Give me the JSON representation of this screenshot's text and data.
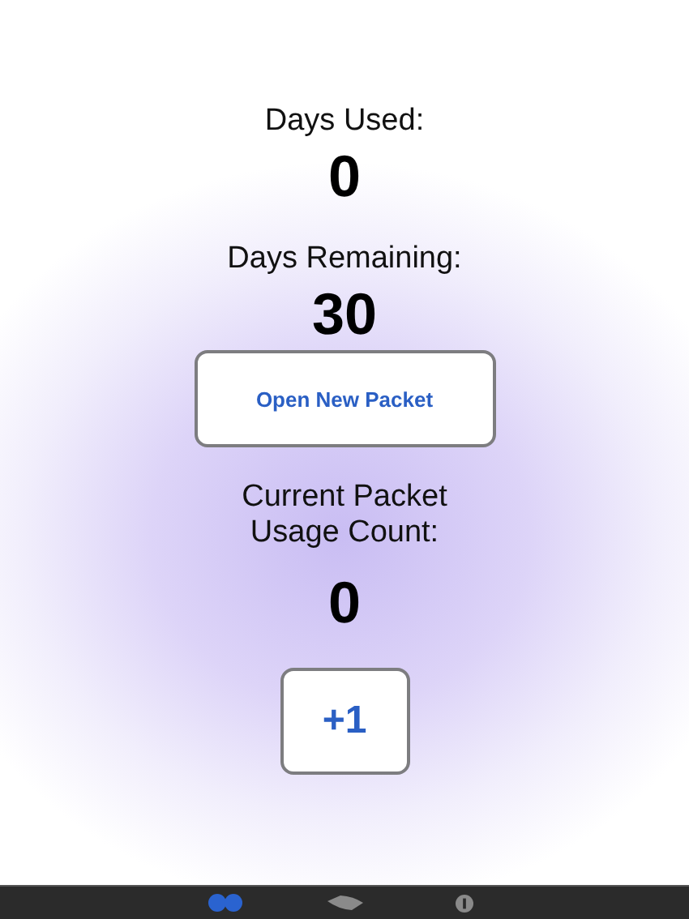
{
  "days_used": {
    "label": "Days Used:",
    "value": "0"
  },
  "days_remaining": {
    "label": "Days Remaining:",
    "value": "30"
  },
  "open_button": {
    "label": "Open New Packet"
  },
  "usage": {
    "label": "Current Packet Usage Count:",
    "value": "0"
  },
  "increment_button": {
    "label": "+1"
  },
  "tabs": [
    {
      "kind": "dots",
      "selected": true
    },
    {
      "kind": "packet",
      "selected": false
    },
    {
      "kind": "info",
      "selected": false
    }
  ]
}
